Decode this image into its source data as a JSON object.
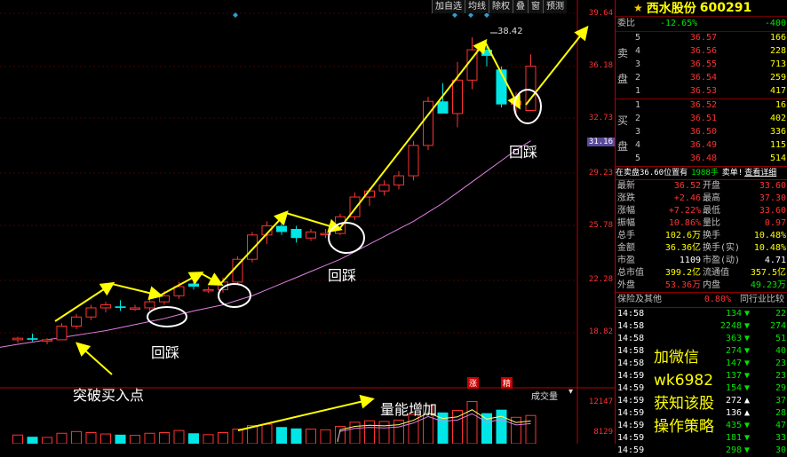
{
  "toolbar": {
    "items": [
      "加自选",
      "均线",
      "除权",
      "叠",
      "窗",
      "预测"
    ]
  },
  "stock": {
    "name": "西水股份",
    "code": "600291"
  },
  "yaxis": {
    "labels": [
      "39.64",
      "36.18",
      "32.73",
      "29.23",
      "25.78",
      "22.28",
      "18.82"
    ],
    "current": "31.16",
    "vol_labels": [
      "12147",
      "8129"
    ],
    "vol_title": "成交量"
  },
  "peak_label": "38.42",
  "annotations": {
    "huicai1": "回踩",
    "huicai2": "回踩",
    "huicai3": "回踩",
    "breakout": "突破买入点",
    "volume": "量能增加",
    "zhang": "涨",
    "jing": "精"
  },
  "promo": {
    "line1": "加微信",
    "line2": "wk6982",
    "line3": "获知该股",
    "line4": "操作策略"
  },
  "weibi": {
    "label": "委比",
    "pct": "-12.65%",
    "diff": "-400"
  },
  "sell": {
    "label_a": "卖",
    "label_b": "盘",
    "rows": [
      {
        "n": "5",
        "p": "36.57",
        "v": "166"
      },
      {
        "n": "4",
        "p": "36.56",
        "v": "228"
      },
      {
        "n": "3",
        "p": "36.55",
        "v": "713"
      },
      {
        "n": "2",
        "p": "36.54",
        "v": "259"
      },
      {
        "n": "1",
        "p": "36.53",
        "v": "417"
      }
    ]
  },
  "buy": {
    "label_a": "买",
    "label_b": "盘",
    "rows": [
      {
        "n": "1",
        "p": "36.52",
        "v": "16"
      },
      {
        "n": "2",
        "p": "36.51",
        "v": "402"
      },
      {
        "n": "3",
        "p": "36.50",
        "v": "336"
      },
      {
        "n": "4",
        "p": "36.49",
        "v": "115"
      },
      {
        "n": "5",
        "p": "36.48",
        "v": "514"
      }
    ]
  },
  "status": {
    "text1": "在卖盘36.60位置有",
    "text2": "1988手",
    "text3": "卖单!",
    "link": "查看详细"
  },
  "quote": [
    {
      "a": "最新",
      "b": "36.52",
      "c": "开盘",
      "d": "33.60"
    },
    {
      "a": "涨跌",
      "b": "+2.46",
      "c": "最高",
      "d": "37.30"
    },
    {
      "a": "涨幅",
      "b": "+7.22%",
      "c": "最低",
      "d": "33.60"
    },
    {
      "a": "振幅",
      "b": "10.86%",
      "c": "量比",
      "d": "0.97"
    },
    {
      "a": "总手",
      "b": "102.6万",
      "c": "换手",
      "d": "10.48%"
    },
    {
      "a": "金额",
      "b": "36.36亿",
      "c": "换手(实)",
      "d": "10.48%"
    },
    {
      "a": "市盈",
      "b": "1109",
      "c": "市盈(动)",
      "d": "4.71"
    },
    {
      "a": "总市值",
      "b": "399.2亿",
      "c": "流通值",
      "d": "357.5亿"
    },
    {
      "a": "外盘",
      "b": "53.36万",
      "c": "内盘",
      "d": "49.23万"
    }
  ],
  "industry": {
    "label": "保险及其他",
    "pct": "0.80%",
    "compare": "同行业比较"
  },
  "ticks": [
    {
      "t": "14:58",
      "v": "134",
      "d": "down",
      "x": "22"
    },
    {
      "t": "14:58",
      "v": "2248",
      "d": "down",
      "x": "274"
    },
    {
      "t": "14:58",
      "v": "363",
      "d": "down",
      "x": "51"
    },
    {
      "t": "14:58",
      "v": "274",
      "d": "down",
      "x": "40"
    },
    {
      "t": "14:58",
      "v": "147",
      "d": "down",
      "x": "23"
    },
    {
      "t": "14:59",
      "v": "137",
      "d": "down",
      "x": "23"
    },
    {
      "t": "14:59",
      "v": "154",
      "d": "down",
      "x": "29"
    },
    {
      "t": "14:59",
      "v": "272",
      "d": "up",
      "x": "37"
    },
    {
      "t": "14:59",
      "v": "136",
      "d": "up",
      "x": "28"
    },
    {
      "t": "14:59",
      "v": "435",
      "d": "down",
      "x": "47"
    },
    {
      "t": "14:59",
      "v": "181",
      "d": "down",
      "x": "33"
    },
    {
      "t": "14:59",
      "v": "298",
      "d": "down",
      "x": "30"
    }
  ],
  "chart_data": {
    "type": "candlestick",
    "y_range": [
      17.5,
      40.0
    ],
    "candles": [
      {
        "o": 18.5,
        "h": 18.7,
        "l": 18.3,
        "c": 18.6
      },
      {
        "o": 18.6,
        "h": 18.9,
        "l": 18.4,
        "c": 18.5
      },
      {
        "o": 18.5,
        "h": 18.6,
        "l": 18.2,
        "c": 18.5
      },
      {
        "o": 18.5,
        "h": 19.6,
        "l": 18.5,
        "c": 19.4
      },
      {
        "o": 19.4,
        "h": 20.2,
        "l": 19.2,
        "c": 20.0
      },
      {
        "o": 20.0,
        "h": 20.8,
        "l": 19.8,
        "c": 20.6
      },
      {
        "o": 20.6,
        "h": 21.0,
        "l": 20.3,
        "c": 20.8
      },
      {
        "o": 20.7,
        "h": 21.1,
        "l": 20.4,
        "c": 20.6
      },
      {
        "o": 20.6,
        "h": 20.8,
        "l": 20.4,
        "c": 20.6
      },
      {
        "o": 20.6,
        "h": 21.2,
        "l": 20.4,
        "c": 21.0
      },
      {
        "o": 21.0,
        "h": 21.7,
        "l": 20.8,
        "c": 21.4
      },
      {
        "o": 21.4,
        "h": 22.3,
        "l": 21.2,
        "c": 22.0
      },
      {
        "o": 22.2,
        "h": 22.5,
        "l": 21.8,
        "c": 22.0
      },
      {
        "o": 21.8,
        "h": 22.0,
        "l": 21.6,
        "c": 21.8
      },
      {
        "o": 21.8,
        "h": 22.6,
        "l": 21.6,
        "c": 22.3
      },
      {
        "o": 22.3,
        "h": 24.0,
        "l": 22.2,
        "c": 23.8
      },
      {
        "o": 23.8,
        "h": 25.6,
        "l": 23.6,
        "c": 25.4
      },
      {
        "o": 25.4,
        "h": 26.3,
        "l": 24.8,
        "c": 26.0
      },
      {
        "o": 26.0,
        "h": 26.4,
        "l": 25.4,
        "c": 25.6
      },
      {
        "o": 25.8,
        "h": 26.0,
        "l": 24.9,
        "c": 25.2
      },
      {
        "o": 25.2,
        "h": 25.8,
        "l": 25.0,
        "c": 25.6
      },
      {
        "o": 25.5,
        "h": 25.8,
        "l": 25.2,
        "c": 25.5
      },
      {
        "o": 25.5,
        "h": 26.8,
        "l": 25.4,
        "c": 26.6
      },
      {
        "o": 26.6,
        "h": 28.2,
        "l": 26.4,
        "c": 27.9
      },
      {
        "o": 27.9,
        "h": 28.5,
        "l": 27.3,
        "c": 28.3
      },
      {
        "o": 28.3,
        "h": 29.0,
        "l": 28.0,
        "c": 28.7
      },
      {
        "o": 28.7,
        "h": 29.6,
        "l": 28.4,
        "c": 29.3
      },
      {
        "o": 29.3,
        "h": 31.6,
        "l": 29.0,
        "c": 31.3
      },
      {
        "o": 31.3,
        "h": 34.5,
        "l": 31.0,
        "c": 34.2
      },
      {
        "o": 34.2,
        "h": 35.4,
        "l": 33.6,
        "c": 33.4
      },
      {
        "o": 33.4,
        "h": 36.8,
        "l": 32.5,
        "c": 35.6
      },
      {
        "o": 35.6,
        "h": 38.42,
        "l": 35.0,
        "c": 37.6
      },
      {
        "o": 37.6,
        "h": 37.8,
        "l": 36.5,
        "c": 37.2
      },
      {
        "o": 36.3,
        "h": 36.5,
        "l": 33.8,
        "c": 34.0
      },
      {
        "o": 34.0,
        "h": 34.8,
        "l": 33.4,
        "c": 34.2
      },
      {
        "o": 33.6,
        "h": 37.3,
        "l": 33.6,
        "c": 36.52
      }
    ],
    "ma": [
      18.2,
      18.35,
      18.5,
      18.65,
      18.8,
      18.95,
      19.1,
      19.3,
      19.5,
      19.7,
      19.9,
      20.15,
      20.4,
      20.6,
      20.8,
      21.1,
      21.4,
      21.8,
      22.2,
      22.6,
      23.0,
      23.4,
      23.8,
      24.3,
      24.8,
      25.3,
      25.8,
      26.3,
      26.9,
      27.5,
      28.2,
      28.9,
      29.6,
      30.3,
      31.0,
      31.6
    ],
    "volume": [
      2500,
      2000,
      1800,
      3000,
      3500,
      3200,
      2800,
      2600,
      2400,
      3000,
      3200,
      3800,
      3000,
      2600,
      3200,
      4200,
      5200,
      5600,
      4800,
      4400,
      4200,
      4000,
      5000,
      6200,
      6600,
      6400,
      6800,
      8400,
      11000,
      9000,
      9600,
      12147,
      8800,
      9800,
      7600,
      8129
    ]
  }
}
